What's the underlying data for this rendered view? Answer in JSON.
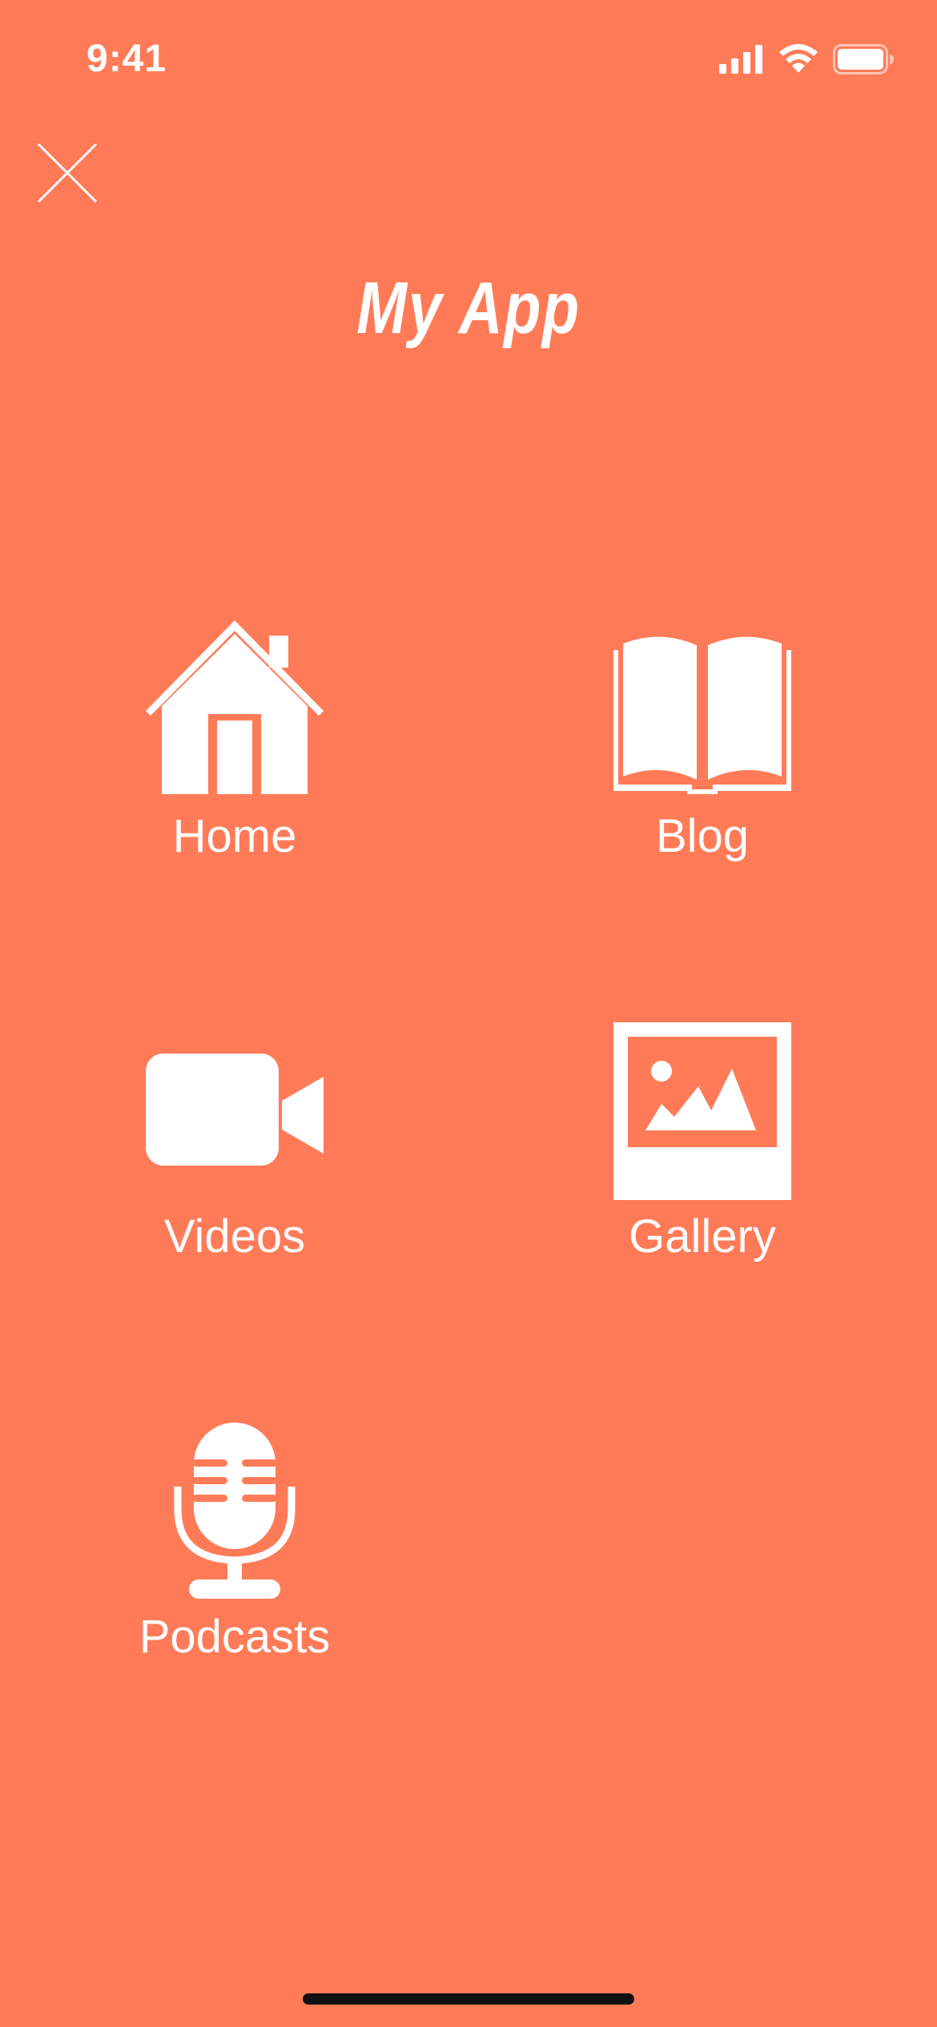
{
  "status_bar": {
    "time": "9:41",
    "icons": [
      "cellular-signal-icon",
      "wifi-icon",
      "battery-icon"
    ]
  },
  "header": {
    "close_icon": "close-icon",
    "title": "My App"
  },
  "menu": {
    "items": [
      {
        "label": "Home",
        "icon": "house-icon"
      },
      {
        "label": "Blog",
        "icon": "open-book-icon"
      },
      {
        "label": "Videos",
        "icon": "video-camera-icon"
      },
      {
        "label": "Gallery",
        "icon": "picture-frame-icon"
      },
      {
        "label": "Podcasts",
        "icon": "microphone-icon"
      }
    ]
  },
  "colors": {
    "background": "#FF7B58",
    "foreground": "#FFFFFF",
    "home_indicator": "#111111"
  }
}
